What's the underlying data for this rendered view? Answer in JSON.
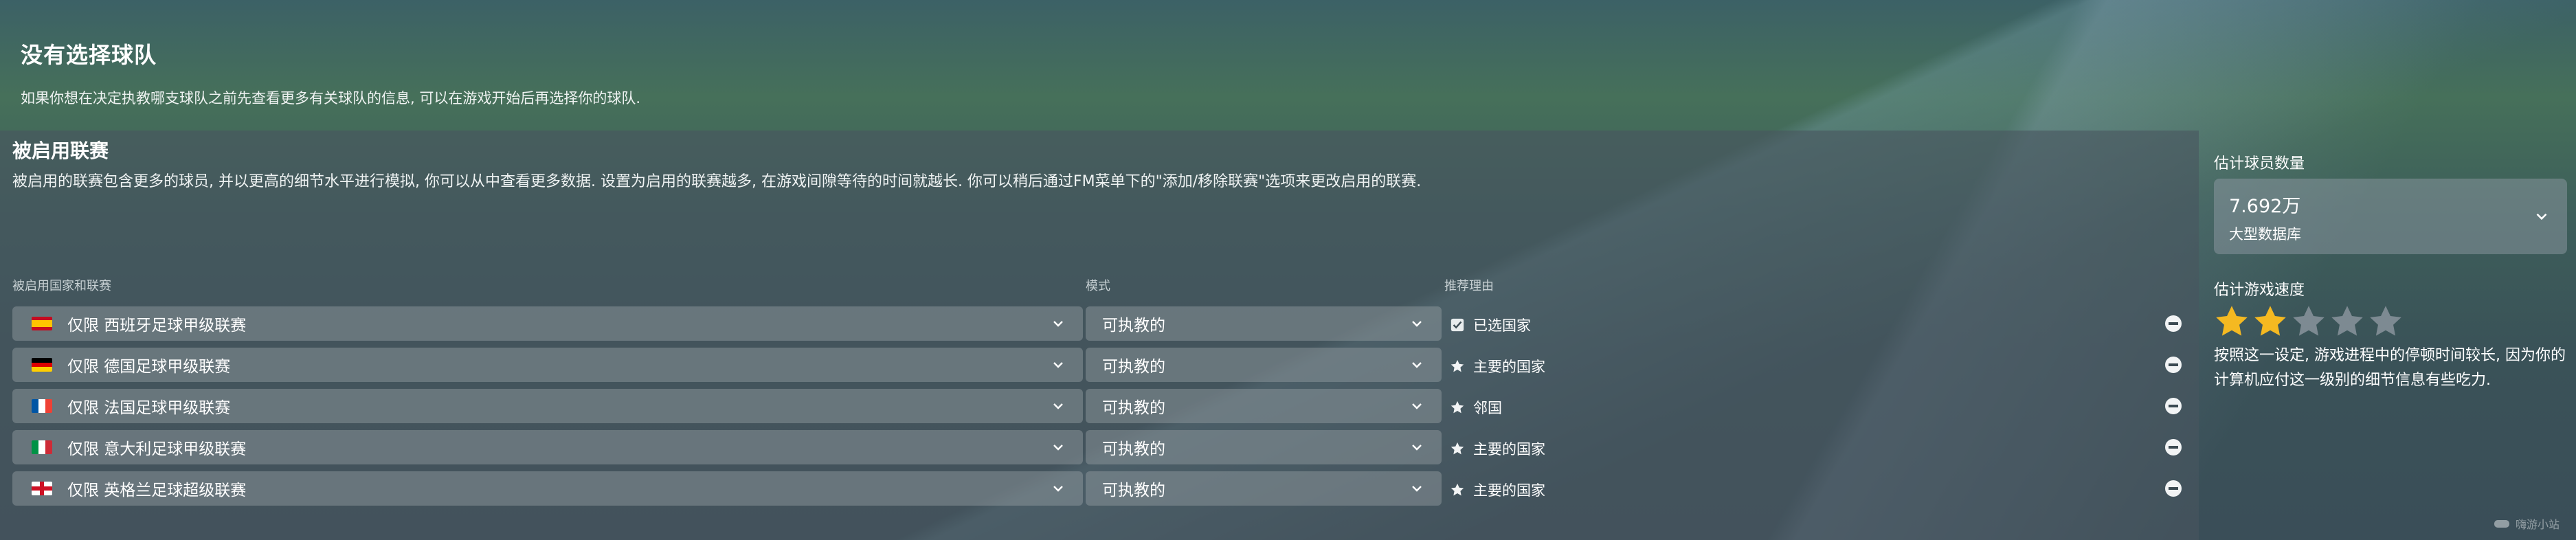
{
  "header": {
    "title": "没有选择球队",
    "subtitle": "如果你想在决定执教哪支球队之前先查看更多有关球队的信息, 可以在游戏开始后再选择你的球队."
  },
  "leagues_panel": {
    "title": "被启用联赛",
    "description": "被启用的联赛包含更多的球员, 并以更高的细节水平进行模拟, 你可以从中查看更多数据. 设置为启用的联赛越多, 在游戏间隙等待的时间就越长. 你可以稍后通过FM菜单下的\"添加/移除联赛\"选项来更改启用的联赛.",
    "columns": {
      "league": "被启用国家和联赛",
      "mode": "模式",
      "reason": "推荐理由"
    },
    "rows": [
      {
        "flag": "spain-flag",
        "league": "仅限 西班牙足球甲级联赛",
        "mode": "可执教的",
        "reason_icon": "check-icon",
        "reason": "已选国家"
      },
      {
        "flag": "germany-flag",
        "league": "仅限 德国足球甲级联赛",
        "mode": "可执教的",
        "reason_icon": "star-icon",
        "reason": "主要的国家"
      },
      {
        "flag": "france-flag",
        "league": "仅限 法国足球甲级联赛",
        "mode": "可执教的",
        "reason_icon": "star-icon",
        "reason": "邻国"
      },
      {
        "flag": "italy-flag",
        "league": "仅限 意大利足球甲级联赛",
        "mode": "可执教的",
        "reason_icon": "star-icon",
        "reason": "主要的国家"
      },
      {
        "flag": "england-flag",
        "league": "仅限 英格兰足球超级联赛",
        "mode": "可执教的",
        "reason_icon": "star-icon",
        "reason": "主要的国家"
      }
    ]
  },
  "sidebar": {
    "player_count_label": "估计球员数量",
    "player_count_value": "7.692万",
    "player_count_sub": "大型数据库",
    "speed_label": "估计游戏速度",
    "speed_rating": 2,
    "speed_max": 5,
    "speed_description": "按照这一设定, 游戏进程中的停顿时间较长, 因为你的计算机应付这一级别的细节信息有些吃力."
  },
  "watermark": "嗨游小站",
  "colors": {
    "star_filled": "#f5b921",
    "star_empty": "#7d8a92",
    "row_bg": "#8f9aa0"
  }
}
